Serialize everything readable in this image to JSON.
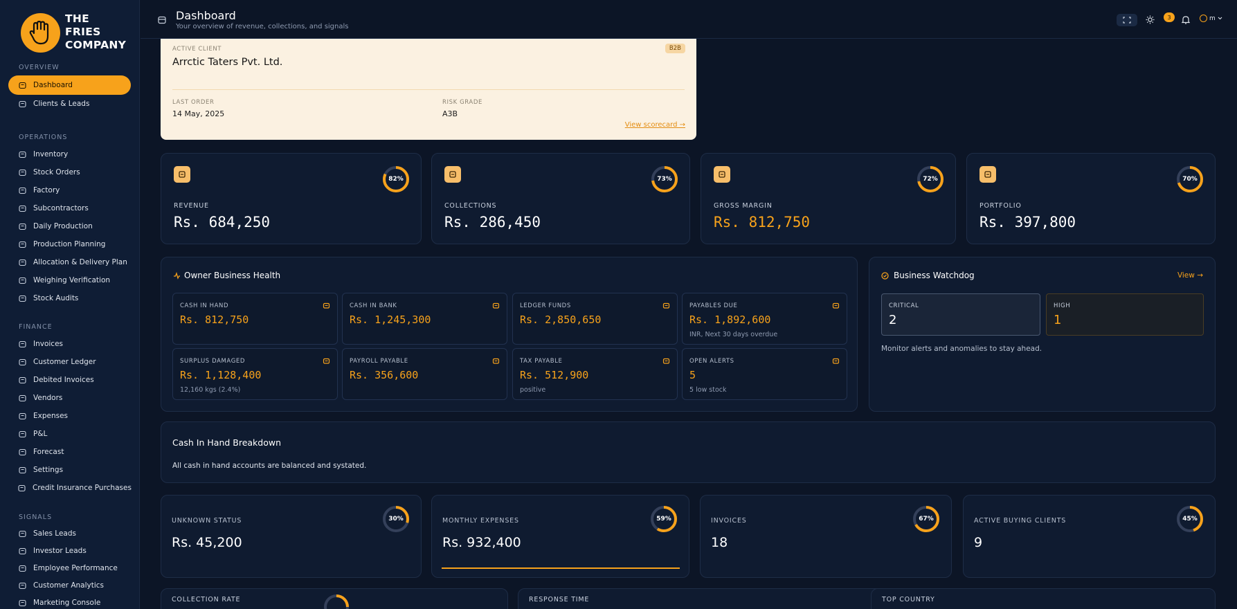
{
  "brand": {
    "line1": "THE",
    "line2": "FRIES",
    "line3": "COMPANY"
  },
  "sidebar": {
    "sections": [
      {
        "label": "OVERVIEW",
        "items": [
          {
            "label": "Dashboard",
            "icon": "dashboard-icon",
            "active": true
          },
          {
            "label": "Clients & Leads",
            "icon": "users-icon"
          }
        ]
      },
      {
        "label": "OPERATIONS",
        "items": [
          {
            "label": "Inventory",
            "icon": "box-icon"
          },
          {
            "label": "Stock Orders",
            "icon": "cart-icon"
          },
          {
            "label": "Factory",
            "icon": "factory-icon"
          },
          {
            "label": "Subcontractors",
            "icon": "handshake-icon"
          },
          {
            "label": "Daily Production",
            "icon": "calendar-icon"
          },
          {
            "label": "Production Planning",
            "icon": "clipboard-icon"
          },
          {
            "label": "Allocation & Delivery Plan",
            "icon": "truck-icon"
          },
          {
            "label": "Weighing Verification",
            "icon": "scale-icon"
          },
          {
            "label": "Stock Audits",
            "icon": "audit-icon"
          }
        ]
      },
      {
        "label": "FINANCE",
        "items": [
          {
            "label": "Invoices",
            "icon": "invoice-icon"
          },
          {
            "label": "Customer Ledger",
            "icon": "ledger-icon"
          },
          {
            "label": "Debited Invoices",
            "icon": "debit-icon"
          },
          {
            "label": "Vendors",
            "icon": "vendor-icon"
          },
          {
            "label": "Expenses",
            "icon": "wallet-icon"
          },
          {
            "label": "P&L",
            "icon": "chart-icon"
          },
          {
            "label": "Forecast",
            "icon": "forecast-icon"
          },
          {
            "label": "Settings",
            "icon": "gear-icon"
          },
          {
            "label": "Credit Insurance Purchases",
            "icon": "shield-icon"
          }
        ]
      },
      {
        "label": "SIGNALS",
        "items": [
          {
            "label": "Sales Leads",
            "icon": "target-icon"
          },
          {
            "label": "Investor Leads",
            "icon": "investor-icon"
          },
          {
            "label": "Employee Performance",
            "icon": "employee-icon"
          },
          {
            "label": "Customer Analytics",
            "icon": "analytics-icon"
          },
          {
            "label": "Marketing Console",
            "icon": "megaphone-icon"
          }
        ]
      }
    ]
  },
  "header": {
    "title": "Dashboard",
    "subtitle": "Your overview of revenue, collections, and signals",
    "notification_count": "3",
    "user_initials": "m"
  },
  "client": {
    "label": "ACTIVE CLIENT",
    "name": "Arrctic Taters Pvt. Ltd.",
    "badge": "B2B",
    "last_order_label": "LAST ORDER",
    "last_order": "14 May, 2025",
    "risk_label": "RISK GRADE",
    "risk": "A3B",
    "link": "View scorecard →"
  },
  "kpis": [
    {
      "label": "REVENUE",
      "value": "Rs. 684,250",
      "percent": 82,
      "percent_label": "82%",
      "highlight": false
    },
    {
      "label": "COLLECTIONS",
      "value": "Rs. 286,450",
      "percent": 73,
      "percent_label": "73%",
      "highlight": false
    },
    {
      "label": "GROSS MARGIN",
      "value": "Rs. 812,750",
      "percent": 72,
      "percent_label": "72%",
      "highlight": true
    },
    {
      "label": "PORTFOLIO",
      "value": "Rs. 397,800",
      "percent": 70,
      "percent_label": "70%",
      "highlight": false
    }
  ],
  "health": {
    "title": "Owner Business Health",
    "cells": [
      {
        "label": "CASH IN HAND",
        "value": "Rs. 812,750",
        "sub": ""
      },
      {
        "label": "CASH IN BANK",
        "value": "Rs. 1,245,300",
        "sub": ""
      },
      {
        "label": "LEDGER FUNDS",
        "value": "Rs. 2,850,650",
        "sub": ""
      },
      {
        "label": "PAYABLES DUE",
        "value": "Rs. 1,892,600",
        "sub": "INR, Next 30 days overdue"
      },
      {
        "label": "SURPLUS DAMAGED",
        "value": "Rs. 1,128,400",
        "sub": "12,160 kgs (2.4%)"
      },
      {
        "label": "PAYROLL PAYABLE",
        "value": "Rs. 356,600",
        "sub": ""
      },
      {
        "label": "TAX PAYABLE",
        "value": "Rs. 512,900",
        "sub": "positive"
      },
      {
        "label": "OPEN ALERTS",
        "value": "5",
        "sub": "5 low stock"
      }
    ]
  },
  "watchdog": {
    "title": "Business Watchdog",
    "view": "View →",
    "critical_label": "CRITICAL",
    "critical": "2",
    "high_label": "HIGH",
    "high": "1",
    "note": "Monitor alerts and anomalies to stay ahead."
  },
  "cash_breakdown": {
    "title": "Cash In Hand Breakdown",
    "text": "All cash in hand accounts are balanced and systated."
  },
  "stats": [
    {
      "label": "UNKNOWN STATUS",
      "value": "Rs. 45,200",
      "percent": 30,
      "percent_label": "30%"
    },
    {
      "label": "MONTHLY EXPENSES",
      "value": "Rs. 932,400",
      "percent": 59,
      "percent_label": "59%"
    },
    {
      "label": "INVOICES",
      "value": "18",
      "percent": 67,
      "percent_label": "67%"
    },
    {
      "label": "ACTIVE BUYING CLIENTS",
      "value": "9",
      "percent": 45,
      "percent_label": "45%"
    }
  ],
  "bottom": {
    "collection_rate": "COLLECTION RATE",
    "response_time": "RESPONSE TIME",
    "top_country": "TOP COUNTRY"
  },
  "colors": {
    "accent": "#f7a21b",
    "bg": "#0c1526",
    "card": "#0f1b30"
  }
}
